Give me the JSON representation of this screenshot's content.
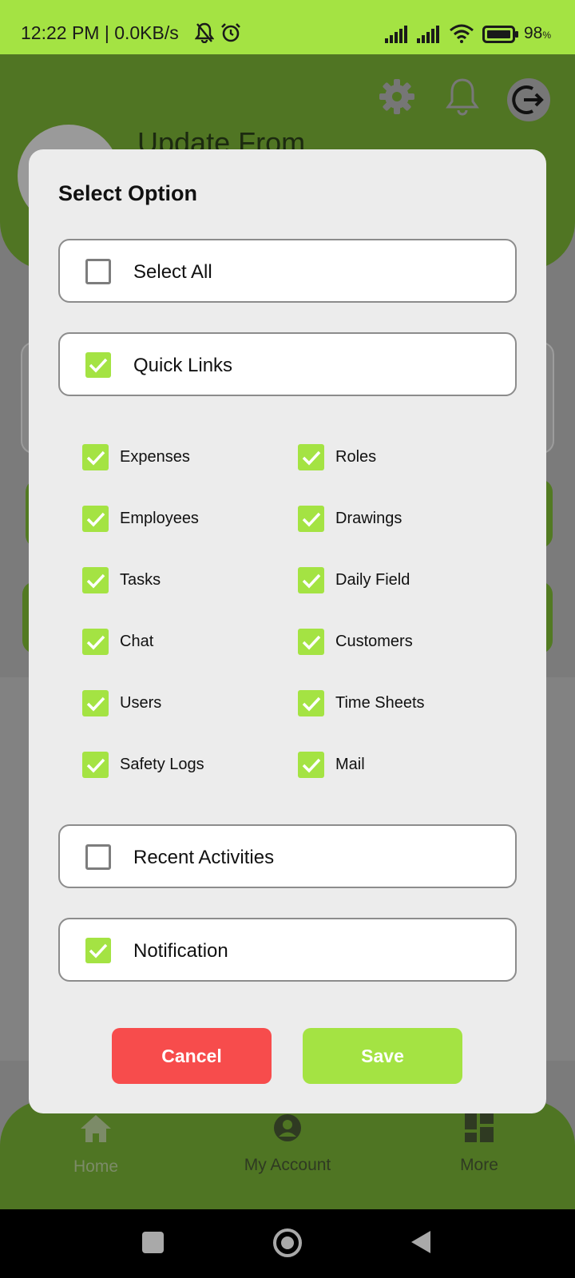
{
  "status_bar": {
    "time": "12:22 PM | 0.0KB/s",
    "battery": "98",
    "battery_unit": "%"
  },
  "header": {
    "title": "Update From",
    "icons": [
      "gear-icon",
      "bell-icon",
      "logout-icon"
    ]
  },
  "dialog": {
    "title": "Select Option",
    "options": {
      "select_all": {
        "label": "Select All",
        "checked": false
      },
      "quick_links": {
        "label": "Quick Links",
        "checked": true
      },
      "recent_activities": {
        "label": "Recent Activities",
        "checked": false
      },
      "notification": {
        "label": "Notification",
        "checked": true
      }
    },
    "quick_link_items": [
      {
        "label": "Expenses",
        "checked": true
      },
      {
        "label": "Roles",
        "checked": true
      },
      {
        "label": "Employees",
        "checked": true
      },
      {
        "label": "Drawings",
        "checked": true
      },
      {
        "label": "Tasks",
        "checked": true
      },
      {
        "label": "Daily Field",
        "checked": true
      },
      {
        "label": "Chat",
        "checked": true
      },
      {
        "label": "Customers",
        "checked": true
      },
      {
        "label": "Users",
        "checked": true
      },
      {
        "label": "Time Sheets",
        "checked": true
      },
      {
        "label": "Safety Logs",
        "checked": true
      },
      {
        "label": "Mail",
        "checked": true
      }
    ],
    "cancel_label": "Cancel",
    "save_label": "Save"
  },
  "bottom_nav": {
    "items": [
      {
        "label": "Home",
        "icon": "home-icon"
      },
      {
        "label": "My Account",
        "icon": "account-icon"
      },
      {
        "label": "More",
        "icon": "grid-icon"
      }
    ]
  },
  "colors": {
    "accent": "#a4e343",
    "header": "#507523",
    "cancel": "#f74c4c"
  }
}
